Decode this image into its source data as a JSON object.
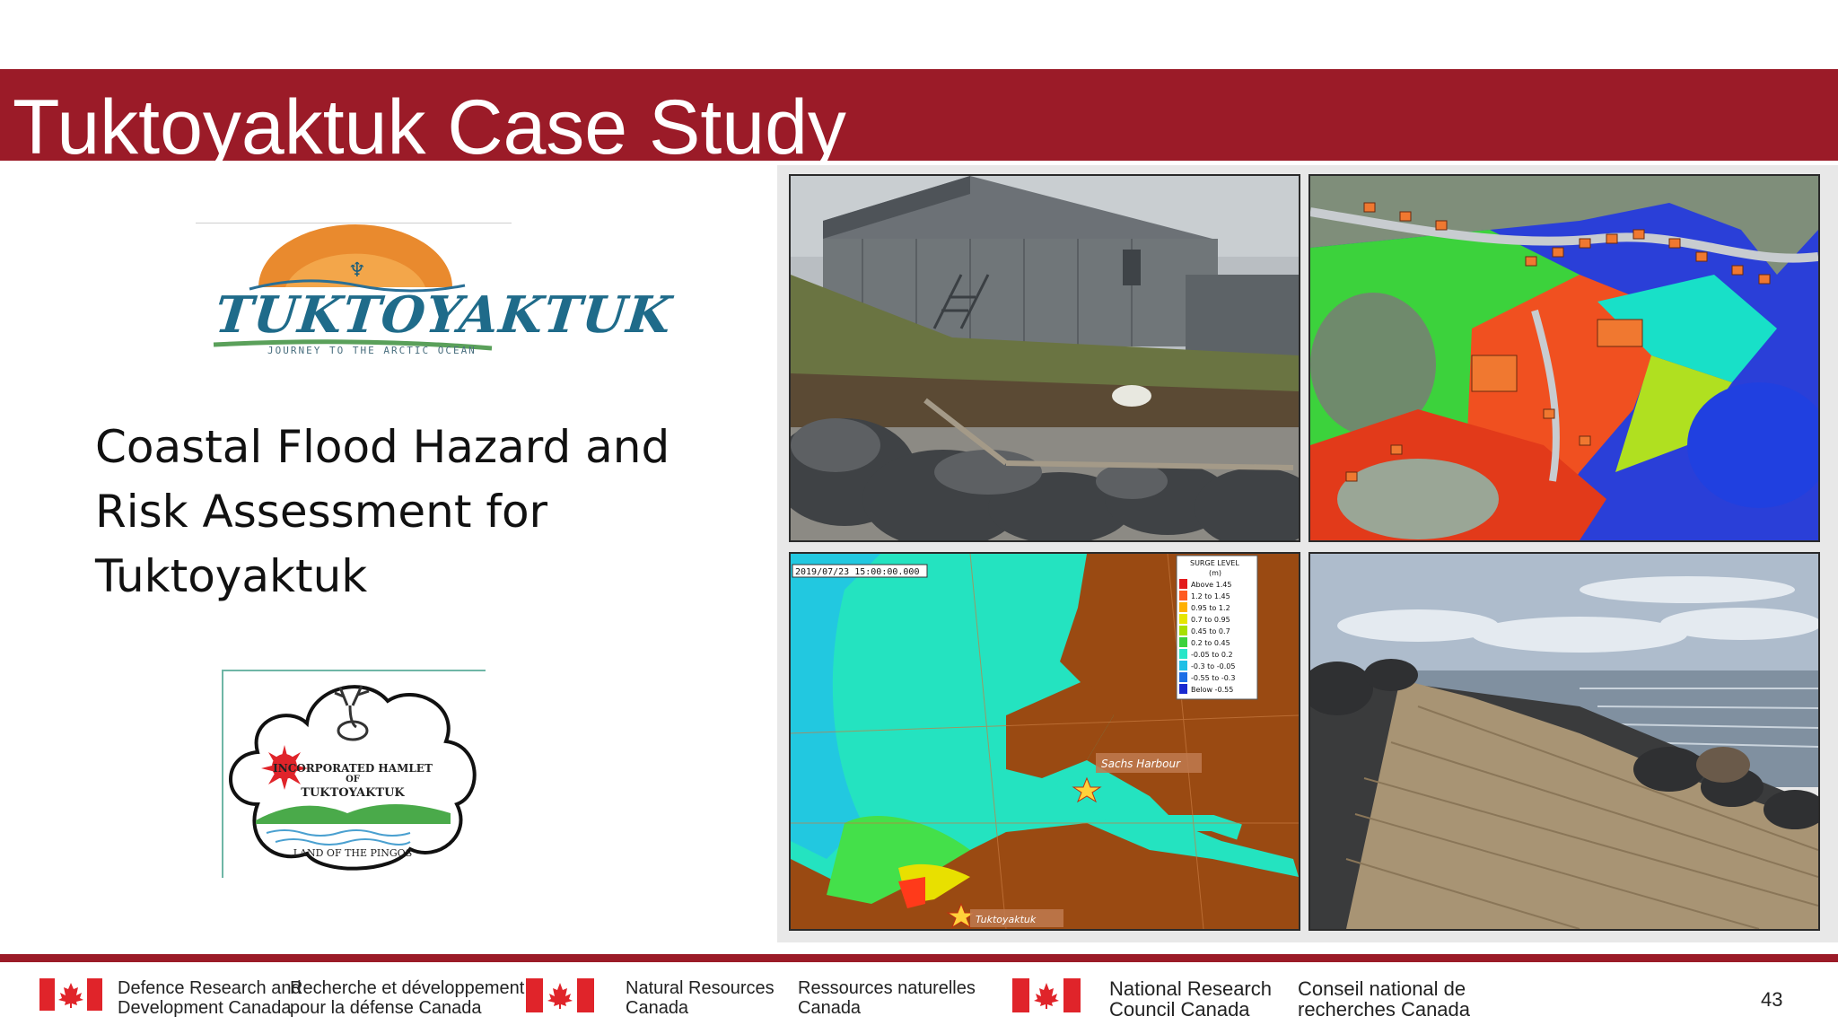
{
  "slide": {
    "title": "Tuktoyaktuk Case Study",
    "subtitle_lines": [
      "Coastal Flood Hazard and",
      "Risk Assessment for",
      "Tuktoyaktuk"
    ],
    "page_number": "43"
  },
  "logos": {
    "tourism": {
      "wordmark": "TUKTOYAKTUK",
      "tagline": "JOURNEY TO THE ARCTIC OCEAN"
    },
    "hamlet": {
      "line1": "INCORPORATED HAMLET",
      "line2": "OF",
      "line3": "TUKTOYAKTUK",
      "motto": "LAND OF THE PINGOS"
    }
  },
  "photos": {
    "surge_map": {
      "timestamp": "2019/07/23 15:00:00.000",
      "legend_title": "SURGE LEVEL",
      "legend_unit": "(m)",
      "legend_items": [
        {
          "label": "Above 1.45",
          "color": "#e31a1c"
        },
        {
          "label": "1.2 to 1.45",
          "color": "#ff5a1f"
        },
        {
          "label": "0.95 to 1.2",
          "color": "#ffb000"
        },
        {
          "label": "0.7 to 0.95",
          "color": "#e6e600"
        },
        {
          "label": "0.45 to 0.7",
          "color": "#a8e000"
        },
        {
          "label": "0.2 to 0.45",
          "color": "#3cd23c"
        },
        {
          "label": "-0.05 to 0.2",
          "color": "#28e6c8"
        },
        {
          "label": "-0.3 to -0.05",
          "color": "#1ebfe6"
        },
        {
          "label": "-0.55 to -0.3",
          "color": "#1c6ee6"
        },
        {
          "label": "Below -0.55",
          "color": "#1a2ad0"
        }
      ],
      "place_sachs": "Sachs Harbour",
      "place_tuk": "Tuktoyaktuk"
    }
  },
  "footer": {
    "drdc_en": [
      "Defence Research and",
      "Development Canada"
    ],
    "drdc_fr": [
      "Recherche et développement",
      "pour la défense Canada"
    ],
    "nrcan_en": [
      "Natural Resources",
      "Canada"
    ],
    "nrcan_fr": [
      "Ressources naturelles",
      "Canada"
    ],
    "nrc_en": [
      "National Research",
      "Council Canada"
    ],
    "nrc_fr": [
      "Conseil national de",
      "recherches Canada"
    ]
  },
  "colors": {
    "accent": "#9b1b28",
    "flag_red": "#e0242a"
  }
}
